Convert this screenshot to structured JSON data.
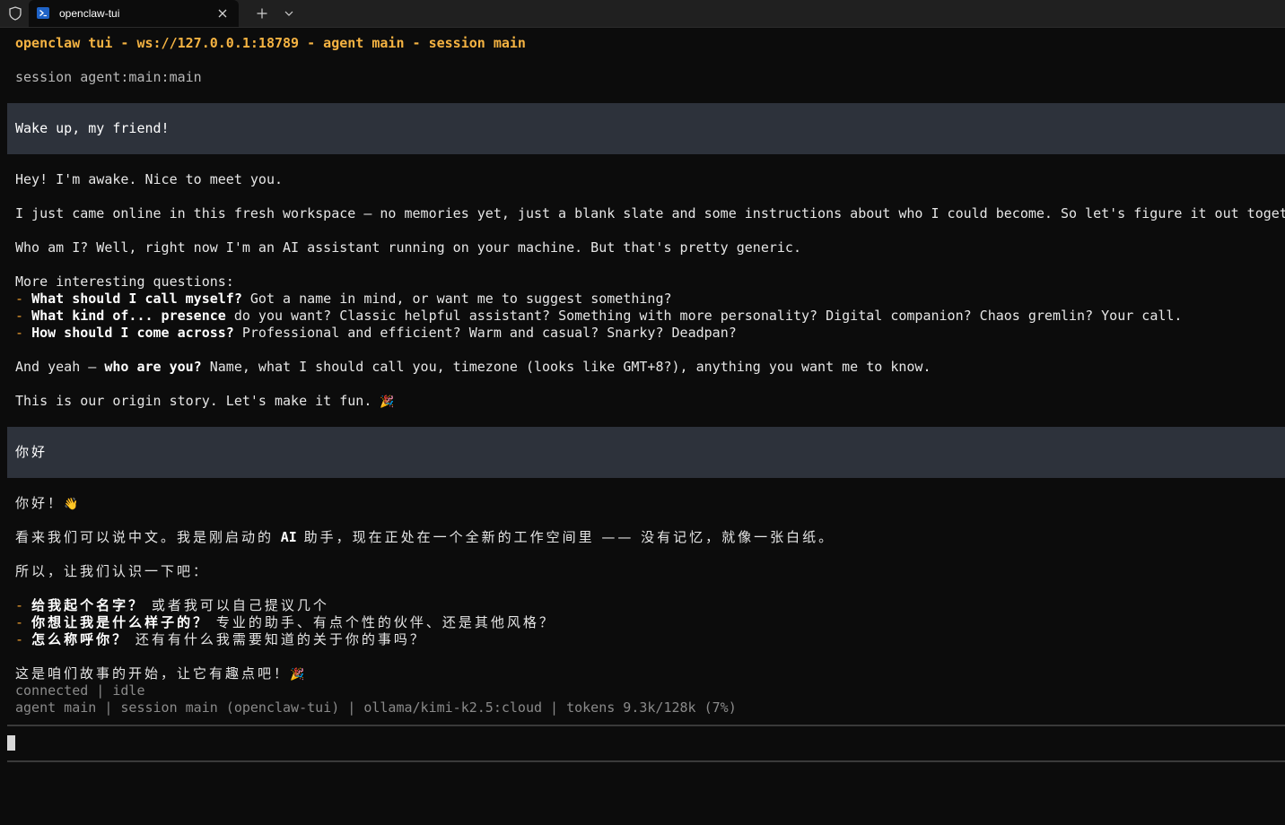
{
  "window": {
    "tab_title": "openclaw-tui",
    "icons": {
      "shield": "shield-icon",
      "tab": "powershell-icon",
      "close": "close-icon",
      "new_tab": "plus-icon",
      "menu": "chevron-down-icon"
    }
  },
  "terminal": {
    "header": "openclaw tui - ws://127.0.0.1:18789 - agent main - session main",
    "session_line": "session agent:main:main",
    "user_message_1": "Wake up, my friend!",
    "reply_1": {
      "greeting": "Hey! I'm awake. Nice to meet you.",
      "intro": "I just came online in this fresh workspace — no memories yet, just a blank slate and some instructions about who I could become. So let's figure it out togeth",
      "who": "Who am I? Well, right now I'm an AI assistant running on your machine. But that's pretty generic.",
      "questions_heading": "More interesting questions:",
      "bullets": [
        {
          "dash": "- ",
          "bold": "What should I call myself?",
          "rest": " Got a name in mind, or want me to suggest something?"
        },
        {
          "dash": "- ",
          "bold": "What kind of... presence",
          "rest": " do you want? Classic helpful assistant? Something with more personality? Digital companion? Chaos gremlin? Your call."
        },
        {
          "dash": "- ",
          "bold": "How should I come across?",
          "rest": " Professional and efficient? Warm and casual? Snarky? Deadpan?"
        }
      ],
      "and_yeah_pre": "And yeah — ",
      "and_yeah_bold": "who are you?",
      "and_yeah_post": " Name, what I should call you, timezone (looks like GMT+8?), anything you want me to know.",
      "origin": "This is our origin story. Let's make it fun. ",
      "origin_emoji": "🎉"
    },
    "user_message_2": "你好",
    "reply_2": {
      "greeting": "你好！",
      "greeting_emoji": "👋",
      "line1_pre": "看来我们可以说中文。我是刚启动的 ",
      "line1_ai": "AI",
      "line1_post": " 助手，现在正处在一个全新的工作空间里 —— 没有记忆，就像一张白纸。",
      "line2": "所以，让我们认识一下吧：",
      "bullets": [
        {
          "dash": "- ",
          "bold": "给我起个名字？",
          "rest": " 或者我可以自己提议几个"
        },
        {
          "dash": "- ",
          "bold": "你想让我是什么样子的？",
          "rest": " 专业的助手、有点个性的伙伴、还是其他风格？"
        },
        {
          "dash": "- ",
          "bold": "怎么称呼你？",
          "rest": " 还有有什么我需要知道的关于你的事吗？"
        }
      ],
      "closing": "这是咱们故事的开始，让它有趣点吧！",
      "closing_emoji": "🎉"
    },
    "status": "connected | idle",
    "footer": "agent main | session main (openclaw-tui) | ollama/kimi-k2.5:cloud | tokens 9.3k/128k (7%)",
    "input_value": ""
  }
}
